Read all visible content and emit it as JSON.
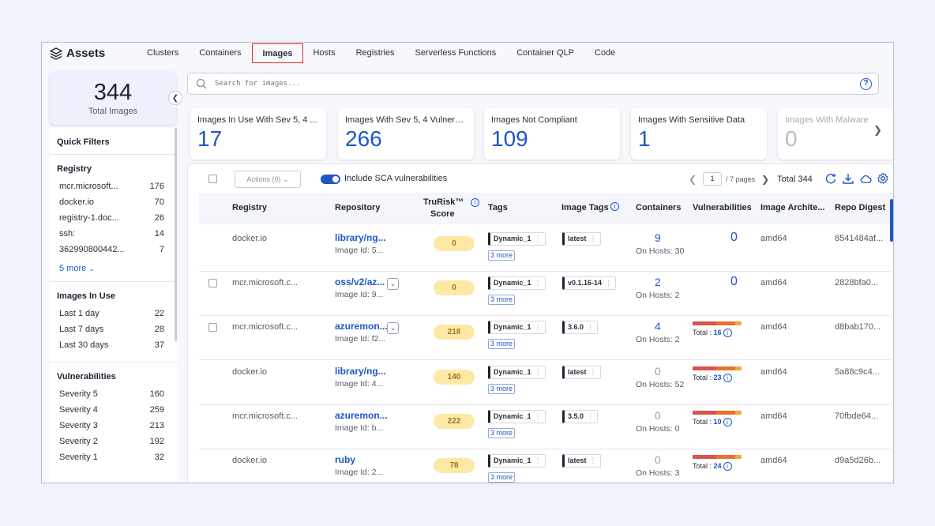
{
  "nav": {
    "title": "Assets",
    "tabs": [
      "Clusters",
      "Containers",
      "Images",
      "Hosts",
      "Registries",
      "Serverless Functions",
      "Container QLP",
      "Code"
    ]
  },
  "total": {
    "value": "344",
    "label": "Total Images"
  },
  "filters": {
    "quick_title": "Quick Filters",
    "registry": {
      "title": "Registry",
      "items": [
        {
          "label": "mcr.microsoft...",
          "count": "176"
        },
        {
          "label": "docker.io",
          "count": "70"
        },
        {
          "label": "registry-1.doc...",
          "count": "26"
        },
        {
          "label": "ssh:",
          "count": "14"
        },
        {
          "label": "362990800442...",
          "count": "7"
        }
      ],
      "more": "5 more"
    },
    "in_use": {
      "title": "Images In Use",
      "items": [
        {
          "label": "Last 1 day",
          "count": "22"
        },
        {
          "label": "Last 7 days",
          "count": "28"
        },
        {
          "label": "Last 30 days",
          "count": "37"
        }
      ]
    },
    "vulns": {
      "title": "Vulnerabilities",
      "items": [
        {
          "label": "Severity 5",
          "count": "160"
        },
        {
          "label": "Severity 4",
          "count": "259"
        },
        {
          "label": "Severity 3",
          "count": "213"
        },
        {
          "label": "Severity 2",
          "count": "192"
        },
        {
          "label": "Severity 1",
          "count": "32"
        }
      ]
    }
  },
  "search": {
    "placeholder": "Search for images..."
  },
  "kpis": [
    {
      "label": "Images In Use With Sev 5, 4 ...",
      "value": "17"
    },
    {
      "label": "Images With Sev 5, 4 Vulnera...",
      "value": "266"
    },
    {
      "label": "Images Not Compliant",
      "value": "109"
    },
    {
      "label": "Images With Sensitive Data",
      "value": "1"
    },
    {
      "label": "Images With Malware",
      "value": "0"
    }
  ],
  "toolbar": {
    "actions": "Actions (0)",
    "sca_label": "Include SCA vulnerabilities",
    "page": "1",
    "pages": "/  7 pages",
    "total": "Total 344"
  },
  "columns": {
    "registry": "Registry",
    "repository": "Repository",
    "trurisk": "TruRisk™",
    "trurisk2": "Score",
    "tags": "Tags",
    "image_tags": "Image Tags",
    "containers": "Containers",
    "vulnerabilities": "Vulnerabilities",
    "arch": "Image Archite...",
    "digest": "Repo Digest"
  },
  "rows": [
    {
      "registry": "docker.io",
      "repo": "library/ng...",
      "image_id": "Image Id: 5...",
      "score": "0",
      "tag": "Dynamic_1",
      "more": "3 more",
      "image_tag": "latest",
      "containers": "9",
      "hosts": "On Hosts: 30",
      "vuln_count": "0",
      "vuln_total": "",
      "arch": "amd64",
      "digest": "8541484af..."
    },
    {
      "registry": "mcr.microsoft.c...",
      "repo": "oss/v2/az...",
      "image_id": "Image Id: 9...",
      "score": "0",
      "tag": "Dynamic_1",
      "more": "3 more",
      "image_tag": "v0.1.16-14",
      "containers": "2",
      "hosts": "On Hosts: 2",
      "vuln_count": "0",
      "vuln_total": "",
      "arch": "amd64",
      "digest": "2828bfa0..."
    },
    {
      "registry": "mcr.microsoft.c...",
      "repo": "azuremon...",
      "image_id": "Image Id: f2...",
      "score": "218",
      "tag": "Dynamic_1",
      "more": "3 more",
      "image_tag": "3.6.0",
      "containers": "4",
      "hosts": "On Hosts: 2",
      "vuln_count": "",
      "vuln_total": "16",
      "arch": "amd64",
      "digest": "d8bab170..."
    },
    {
      "registry": "docker.io",
      "repo": "library/ng...",
      "image_id": "Image Id: 4...",
      "score": "140",
      "tag": "Dynamic_1",
      "more": "3 more",
      "image_tag": "latest",
      "containers": "0",
      "hosts": "On Hosts: 52",
      "vuln_count": "",
      "vuln_total": "23",
      "arch": "amd64",
      "digest": "5a88c9c4..."
    },
    {
      "registry": "mcr.microsoft.c...",
      "repo": "azuremon...",
      "image_id": "Image Id: b...",
      "score": "222",
      "tag": "Dynamic_1",
      "more": "3 more",
      "image_tag": "3.5.0",
      "containers": "0",
      "hosts": "On Hosts: 0",
      "vuln_count": "",
      "vuln_total": "10",
      "arch": "amd64",
      "digest": "70fbde64..."
    },
    {
      "registry": "docker.io",
      "repo": "ruby",
      "image_id": "Image Id: 2...",
      "score": "78",
      "tag": "Dynamic_1",
      "more": "3 more",
      "image_tag": "latest",
      "containers": "0",
      "hosts": "On Hosts: 3",
      "vuln_count": "",
      "vuln_total": "24",
      "arch": "amd64",
      "digest": "d9a5d26b..."
    }
  ],
  "vuln_total_prefix": "Total : ",
  "colors": {
    "accent": "#1e56c6",
    "active_tab_border": "#d82c2c",
    "score_bg": "#fde8a6"
  }
}
